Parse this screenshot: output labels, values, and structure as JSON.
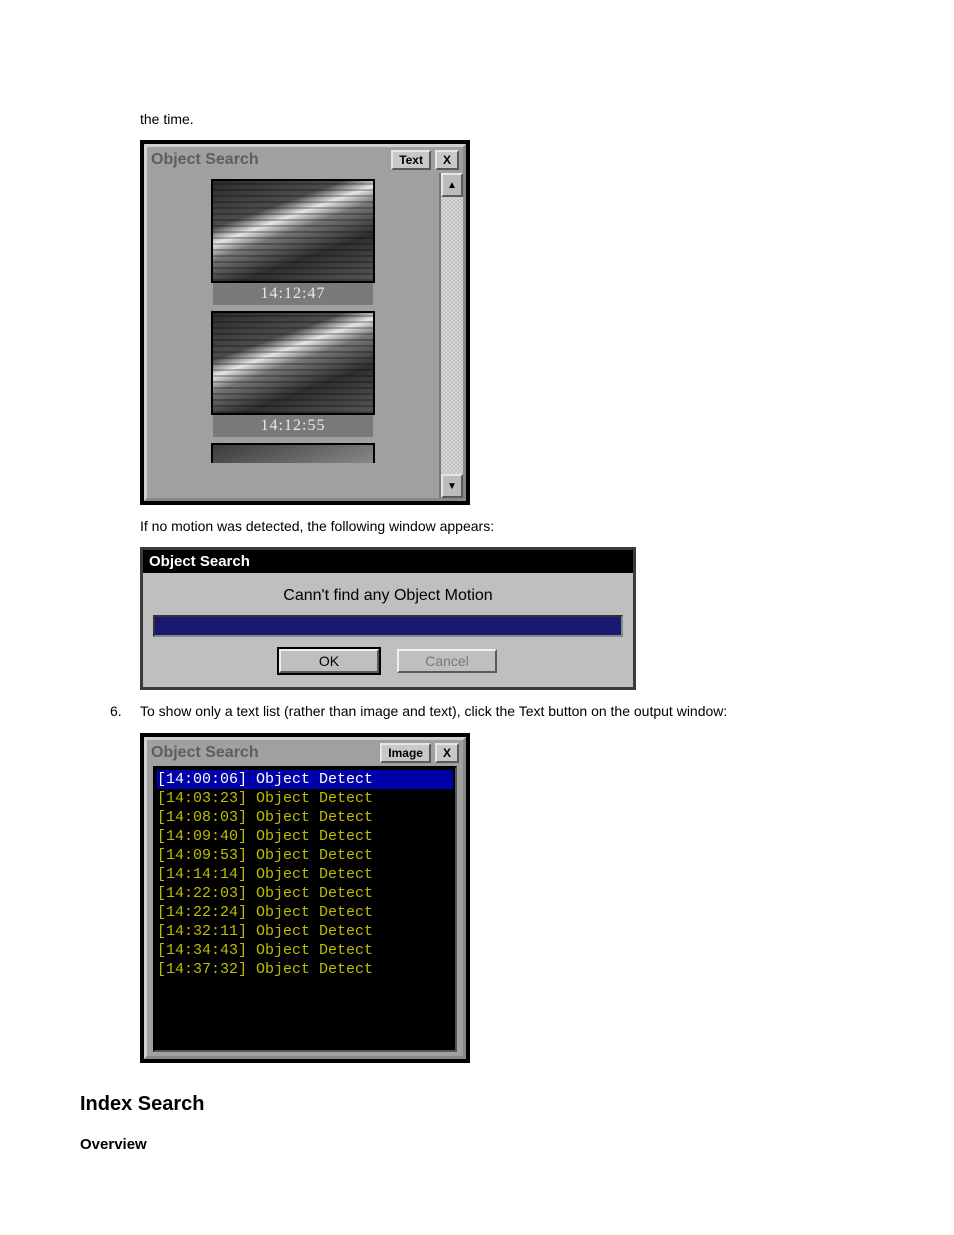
{
  "intro_text": "the time.",
  "no_motion_text": "If no motion was detected, the following window appears:",
  "step6": {
    "number": "6.",
    "text": "To show only a text list (rather than image and text), click the Text button on the output window:"
  },
  "heading_index_search": "Index Search",
  "heading_overview": "Overview",
  "window_thumbs": {
    "title": "Object Search",
    "text_button": "Text",
    "close_button": "X",
    "scroll_up_icon": "▲",
    "scroll_down_icon": "▼",
    "thumbs": [
      {
        "time": "14:12:47"
      },
      {
        "time": "14:12:55"
      }
    ]
  },
  "window_modal": {
    "title": "Object Search",
    "message": "Cann't find any Object Motion",
    "ok": "OK",
    "cancel": "Cancel"
  },
  "window_textlist": {
    "title": "Object Search",
    "image_button": "Image",
    "close_button": "X",
    "rows": [
      {
        "time": "14:00:06",
        "label": "Object Detect",
        "selected": true
      },
      {
        "time": "14:03:23",
        "label": "Object Detect",
        "selected": false
      },
      {
        "time": "14:08:03",
        "label": "Object Detect",
        "selected": false
      },
      {
        "time": "14:09:40",
        "label": "Object Detect",
        "selected": false
      },
      {
        "time": "14:09:53",
        "label": "Object Detect",
        "selected": false
      },
      {
        "time": "14:14:14",
        "label": "Object Detect",
        "selected": false
      },
      {
        "time": "14:22:03",
        "label": "Object Detect",
        "selected": false
      },
      {
        "time": "14:22:24",
        "label": "Object Detect",
        "selected": false
      },
      {
        "time": "14:32:11",
        "label": "Object Detect",
        "selected": false
      },
      {
        "time": "14:34:43",
        "label": "Object Detect",
        "selected": false
      },
      {
        "time": "14:37:32",
        "label": "Object Detect",
        "selected": false
      }
    ]
  }
}
